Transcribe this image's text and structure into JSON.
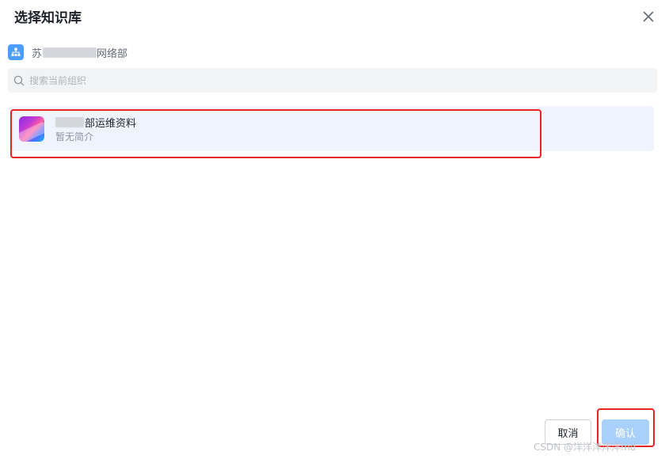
{
  "dialog": {
    "title": "选择知识库",
    "close_label": "✕"
  },
  "org": {
    "icon": "org-structure-icon",
    "prefix": "苏",
    "name_suffix": "网络部"
  },
  "search": {
    "placeholder": "搜索当前组织",
    "value": ""
  },
  "knowledge_bases": [
    {
      "name_suffix": "部运维资料",
      "description": "暂无简介"
    }
  ],
  "buttons": {
    "cancel": "取消",
    "confirm": "确认"
  },
  "watermark": "CSDN @洋洋洋洋洋md",
  "colors": {
    "highlight": "#e62424",
    "selected_bg": "#eef3fd",
    "confirm_disabled": "#a9cffb",
    "org_icon_bg": "#4c9dff"
  }
}
